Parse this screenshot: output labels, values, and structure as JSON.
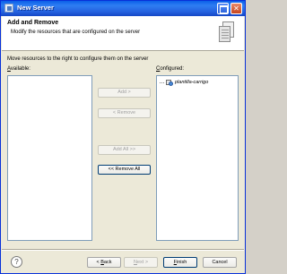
{
  "window": {
    "title": "New Server"
  },
  "header": {
    "title": "Add and Remove",
    "description": "Modify the resources that are configured on the server"
  },
  "main": {
    "instruction": "Move resources to the right to configure them on the server",
    "available_label": "Available:",
    "configured_label": "Configured:",
    "available_items": [],
    "configured_items": [
      {
        "label": "plantilla-carrigo",
        "icon": "web-project-icon"
      }
    ]
  },
  "buttons": {
    "add": "Add >",
    "remove": "< Remove",
    "add_all": "Add All >>",
    "remove_all": "<< Remove All",
    "back": "< Back",
    "next": "Next >",
    "finish": "Finish",
    "cancel": "Cancel"
  },
  "colors": {
    "titlebar": "#2563e0",
    "dialog_bg": "#ece9d8",
    "list_border": "#7f9db9"
  }
}
